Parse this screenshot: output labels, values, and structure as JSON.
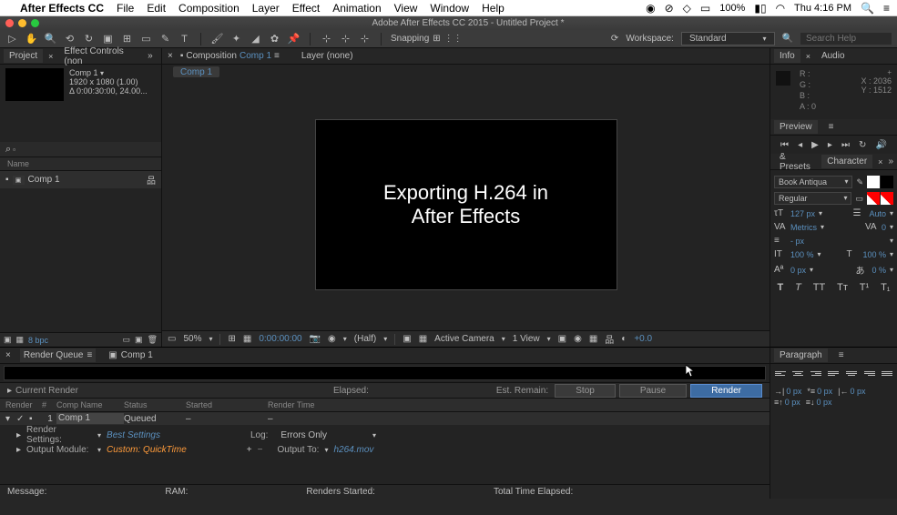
{
  "mac": {
    "app_name": "After Effects CC",
    "menus": [
      "File",
      "Edit",
      "Composition",
      "Layer",
      "Effect",
      "Animation",
      "View",
      "Window",
      "Help"
    ],
    "battery": "100%",
    "day_time": "Thu 4:16 PM"
  },
  "window": {
    "title": "Adobe After Effects CC 2015 - Untitled Project *"
  },
  "toolbar": {
    "snapping_label": "Snapping",
    "workspace_label": "Workspace:",
    "workspace_value": "Standard",
    "search_placeholder": "Search Help"
  },
  "left": {
    "tab_project": "Project",
    "tab_effect_controls": "Effect Controls (non",
    "comp_name": "Comp 1",
    "comp_dims": "1920 x 1080 (1.00)",
    "comp_duration": "Δ 0:00:30:00, 24.00...",
    "header_name": "Name",
    "item_name": "Comp 1",
    "bpc": "8 bpc"
  },
  "viewer": {
    "tab_composition": "Composition",
    "tab_comp_link": "Comp 1",
    "tab_layer": "Layer (none)",
    "subtab": "Comp 1",
    "canvas_line1": "Exporting H.264 in",
    "canvas_line2": "After Effects",
    "zoom": "50%",
    "timecode": "0:00:00:00",
    "half": "(Half)",
    "camera": "Active Camera",
    "view_count": "1 View",
    "exposure": "+0.0"
  },
  "info": {
    "tab_info": "Info",
    "tab_audio": "Audio",
    "R": "R :",
    "G": "G :",
    "B": "B :",
    "A": "A : 0",
    "X": "X : 2036",
    "Y": "Y : 1512"
  },
  "preview": {
    "tab": "Preview"
  },
  "char": {
    "tab_presets": "& Presets",
    "tab_character": "Character",
    "font": "Book Antiqua",
    "style": "Regular",
    "size": "127 px",
    "leading": "Auto",
    "kerning": "Metrics",
    "tracking": "0",
    "dash_px": "- px",
    "hscale": "100 %",
    "vscale": "100 %",
    "baseline": "0 px",
    "tsume": "0 %"
  },
  "render_queue": {
    "tab_rq": "Render Queue",
    "tab_comp": "Comp 1",
    "current_render": "Current Render",
    "elapsed": "Elapsed:",
    "est_remain": "Est. Remain:",
    "stop": "Stop",
    "pause": "Pause",
    "render": "Render",
    "head": [
      "Render",
      "",
      "#",
      "Comp Name",
      "Status",
      "Started",
      "Render Time"
    ],
    "row": {
      "num": "1",
      "comp": "Comp 1",
      "status": "Queued",
      "started": "–",
      "time": "–"
    },
    "settings_label": "Render Settings:",
    "settings_value": "Best Settings",
    "log_label": "Log:",
    "log_value": "Errors Only",
    "output_module_label": "Output Module:",
    "output_module_value": "Custom: QuickTime",
    "output_to_label": "Output To:",
    "output_to_value": "h264.mov",
    "message": "Message:",
    "ram": "RAM:",
    "renders_started": "Renders Started:",
    "total_time": "Total Time Elapsed:"
  },
  "paragraph": {
    "tab": "Paragraph",
    "left_indent": "0 px",
    "right_indent": "0 px",
    "first_indent": "0 px",
    "space_before": "0 px",
    "space_after": "0 px"
  }
}
